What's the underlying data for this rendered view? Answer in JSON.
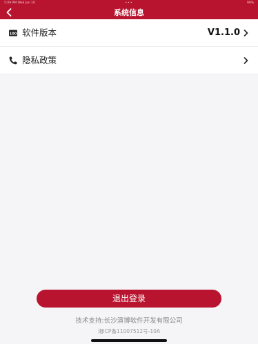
{
  "statusbar": {
    "time": "5:09 PM",
    "date": "Wed Jan 10",
    "dots": "•••",
    "battery": "99%"
  },
  "navbar": {
    "back_icon": "chevron-left-icon",
    "title": "系统信息"
  },
  "list": {
    "items": [
      {
        "icon": "version-badge-icon",
        "label": "软件版本",
        "value": "V1.1.0",
        "chevron": "chevron-right-icon"
      },
      {
        "icon": "phone-icon",
        "label": "隐私政策",
        "value": "",
        "chevron": "chevron-right-icon"
      }
    ]
  },
  "logout_label": "退出登录",
  "footer": {
    "support": "技术支持:长沙演博软件开发有限公司",
    "icp": "湘ICP备11007512号-10A"
  },
  "colors": {
    "brand": "#b8142f",
    "background": "#f5f5f7"
  }
}
